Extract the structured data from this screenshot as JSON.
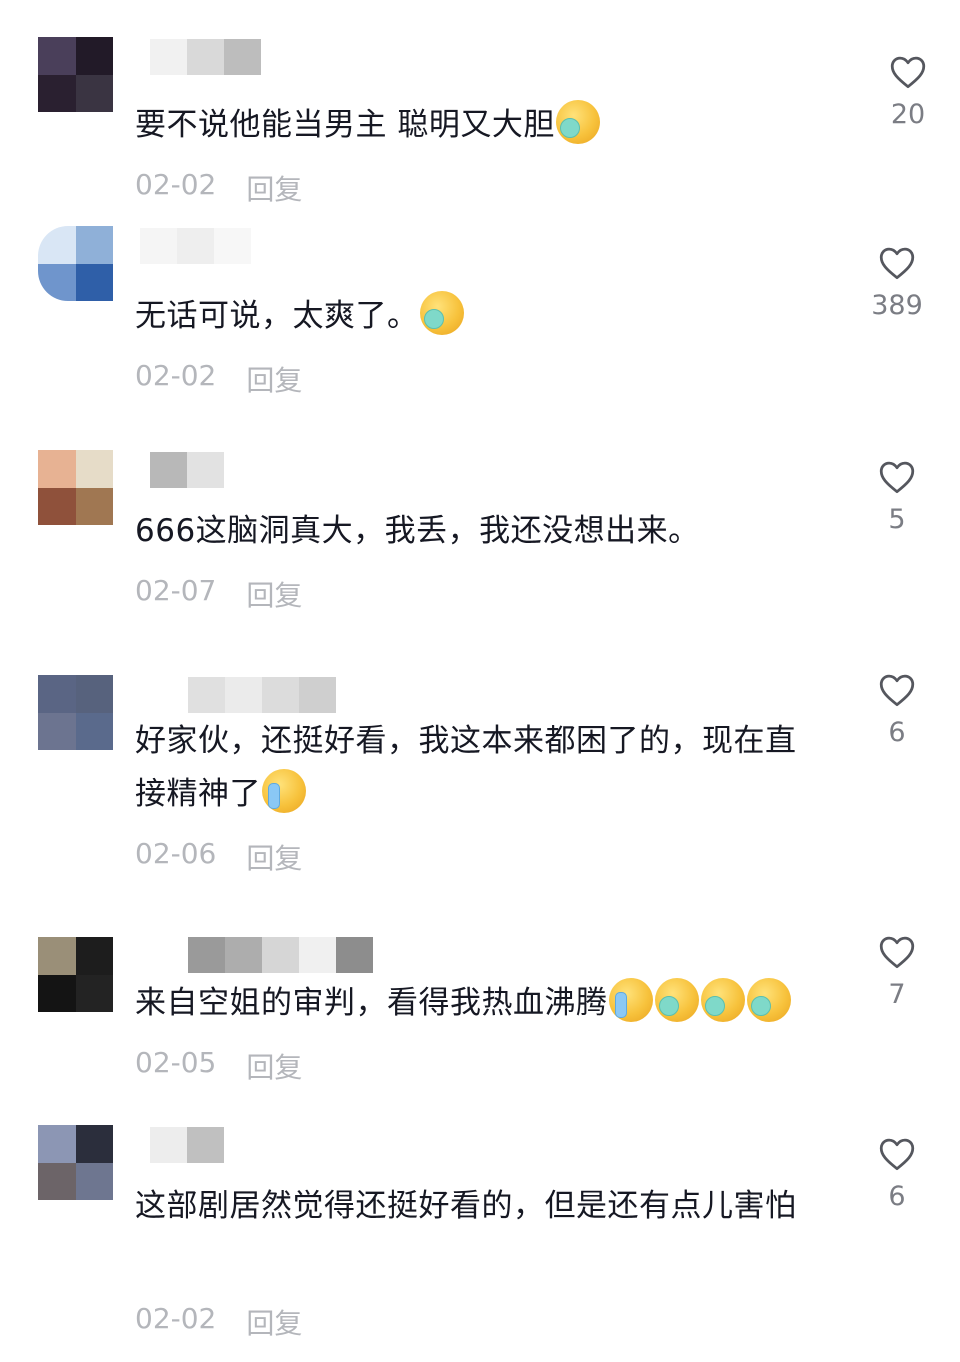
{
  "comments": [
    {
      "text": "要不说他能当男主 聪明又大胆",
      "emojis": [
        "shuang"
      ],
      "date": "02-02",
      "reply_label": "回复",
      "likes": "20",
      "avatar_colors": [
        "#4a3f5a",
        "#221a28",
        "#2a2030",
        "#3a3442"
      ],
      "name_blur_colors": [
        "#f1f1f1",
        "#d9d9d9",
        "#bdbdbd"
      ]
    },
    {
      "text": "无话可说，太爽了。",
      "emojis": [
        "shuang"
      ],
      "date": "02-02",
      "reply_label": "回复",
      "likes": "389",
      "avatar_colors": [
        "#d9e6f5",
        "#8fb0d8",
        "#6f95cc",
        "#2f5fa8"
      ],
      "name_blur_colors": [
        "#f5f5f5",
        "#eeeeee",
        "#f7f7f7"
      ]
    },
    {
      "text": "666这脑洞真大，我丢，我还没想出来。",
      "emojis": [],
      "date": "02-07",
      "reply_label": "回复",
      "likes": "5",
      "avatar_colors": [
        "#e7b293",
        "#e6dcc8",
        "#8f513b",
        "#a07752"
      ],
      "name_blur_colors": [
        "#b8b8b8",
        "#e2e2e2"
      ]
    },
    {
      "text": "好家伙，还挺好看，我这本来都困了的，现在直接精神了",
      "emojis": [
        "cry"
      ],
      "date": "02-06",
      "reply_label": "回复",
      "likes": "6",
      "avatar_colors": [
        "#5a6584",
        "#57627d",
        "#6c7490",
        "#5a6a8c"
      ],
      "name_blur_colors": [
        "#e0e0e0",
        "#ebebeb",
        "#dcdcdc",
        "#cfcfcf"
      ]
    },
    {
      "text": "来自空姐的审判，看得我热血沸腾",
      "emojis": [
        "cry",
        "shuang",
        "shuang",
        "shuang"
      ],
      "date": "02-05",
      "reply_label": "回复",
      "likes": "7",
      "avatar_colors": [
        "#9a8f78",
        "#1d1d1d",
        "#141414",
        "#232323"
      ],
      "name_blur_colors": [
        "#9a9a9a",
        "#adadad",
        "#d6d6d6",
        "#f0f0f0",
        "#8d8d8d"
      ]
    },
    {
      "text": "这部剧居然觉得还挺好看的，但是还有点儿害怕",
      "emojis": [],
      "date": "02-02",
      "reply_label": "回复",
      "likes": "6",
      "avatar_colors": [
        "#8c96b4",
        "#2b2e3c",
        "#6c6468",
        "#6e7690"
      ],
      "name_blur_colors": [
        "#ededed",
        "#c0c0c0"
      ]
    }
  ]
}
